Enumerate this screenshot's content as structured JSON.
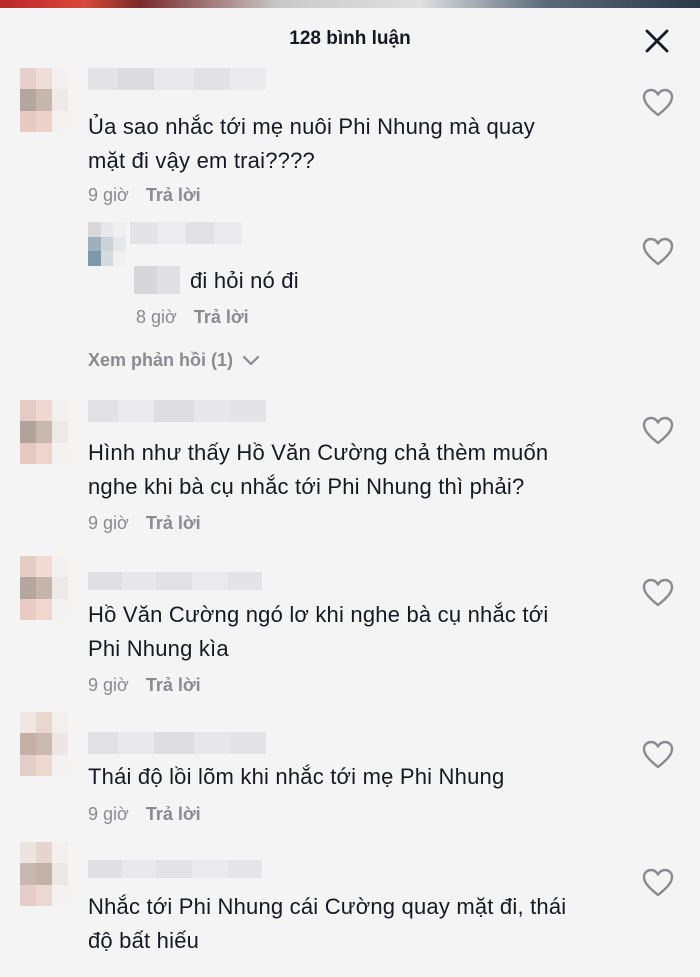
{
  "header": {
    "title": "128 bình luận"
  },
  "comments": [
    {
      "text_line1": "Ủa sao nhắc tới mẹ nuôi Phi Nhung mà quay",
      "text_line2": "mặt đi vậy em trai????",
      "time": "9 giờ",
      "reply_label": "Trả lời"
    },
    {
      "text_line1": "Hình như thấy Hồ Văn Cường chả thèm muốn",
      "text_line2": "nghe khi bà cụ nhắc tới Phi Nhung thì phải?",
      "time": "9 giờ",
      "reply_label": "Trả lời"
    },
    {
      "text_line1": "Hồ Văn Cường ngó lơ khi nghe bà cụ nhắc tới",
      "text_line2": "Phi Nhung kìa",
      "time": "9 giờ",
      "reply_label": "Trả lời"
    },
    {
      "text_line1": "Thái độ lồi lõm khi nhắc tới mẹ Phi Nhung",
      "time": "9 giờ",
      "reply_label": "Trả lời"
    },
    {
      "text_line1": "Nhắc tới Phi Nhung cái Cường quay mặt đi, thái",
      "text_line2": "độ bất hiếu"
    }
  ],
  "reply": {
    "text": "đi hỏi nó đi",
    "time": "8 giờ",
    "reply_label": "Trả lời"
  },
  "view_replies": {
    "label": "Xem phản hồi (1)"
  },
  "icons": {
    "close": "close-icon",
    "like": "heart-outline-icon",
    "expand": "chevron-down-icon"
  }
}
